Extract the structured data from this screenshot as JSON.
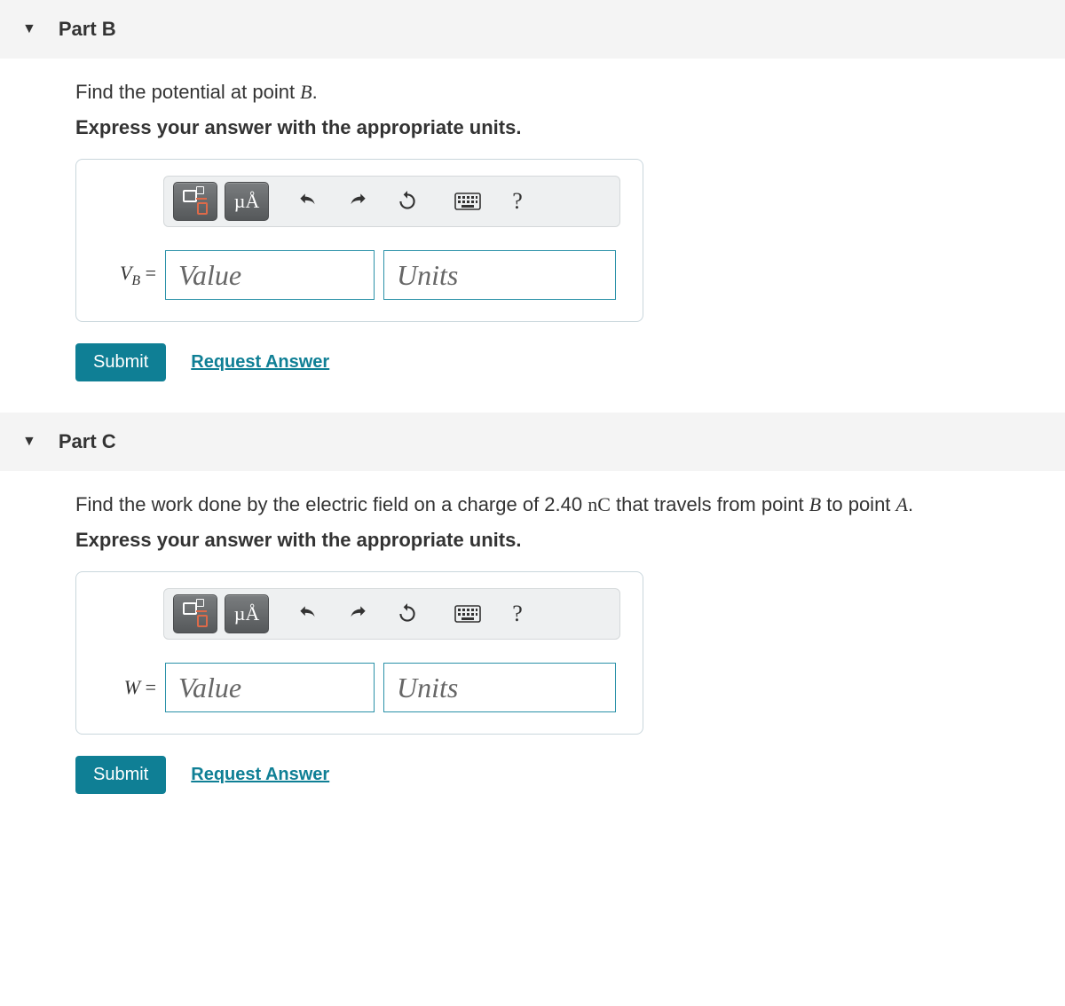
{
  "partB": {
    "header": "Part B",
    "prompt_prefix": "Find the potential at point ",
    "prompt_var": "B",
    "prompt_suffix": ".",
    "instruction": "Express your answer with the appropriate units.",
    "toolbar": {
      "mua_label": "µÅ",
      "help_label": "?"
    },
    "lhs_var": "V",
    "lhs_sub": "B",
    "lhs_eq": " = ",
    "value_placeholder": "Value",
    "units_placeholder": "Units",
    "submit_label": "Submit",
    "request_label": "Request Answer"
  },
  "partC": {
    "header": "Part C",
    "prompt_p1": "Find the work done by the electric field on a charge of 2.40 ",
    "prompt_unit": "nC",
    "prompt_p2": " that travels from point ",
    "prompt_varB": "B",
    "prompt_p3": " to point ",
    "prompt_varA": "A",
    "prompt_p4": ".",
    "instruction": "Express your answer with the appropriate units.",
    "toolbar": {
      "mua_label": "µÅ",
      "help_label": "?"
    },
    "lhs_var": "W",
    "lhs_eq": " = ",
    "value_placeholder": "Value",
    "units_placeholder": "Units",
    "submit_label": "Submit",
    "request_label": "Request Answer"
  }
}
